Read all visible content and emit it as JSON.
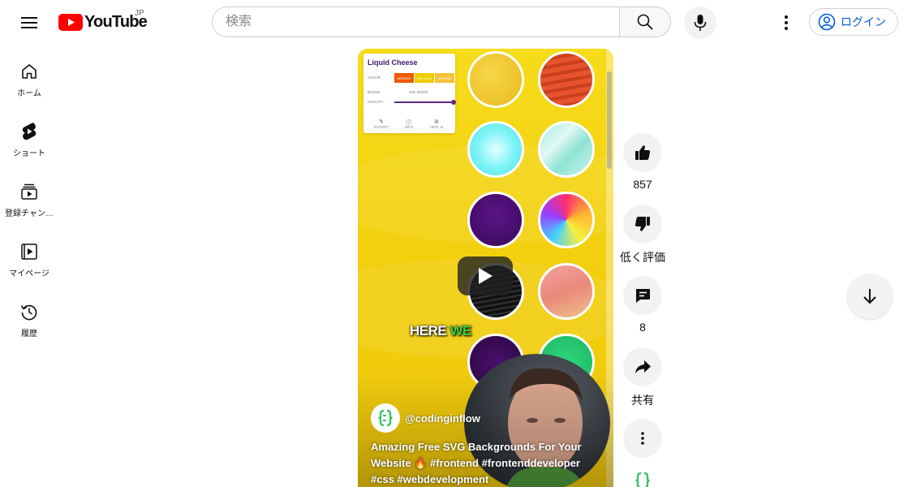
{
  "header": {
    "logo_text": "YouTube",
    "country_code": "JP",
    "search_placeholder": "検索",
    "login_label": "ログイン"
  },
  "sidebar": {
    "items": [
      {
        "label": "ホーム",
        "icon": "home-icon"
      },
      {
        "label": "ショート",
        "icon": "shorts-icon"
      },
      {
        "label": "登録チャン…",
        "icon": "subscriptions-icon"
      },
      {
        "label": "マイページ",
        "icon": "my-page-icon"
      },
      {
        "label": "履歴",
        "icon": "history-icon"
      }
    ]
  },
  "video": {
    "panel": {
      "title": "Liquid Cheese",
      "color_label": "COLOR",
      "swatches": [
        "#EE5A00",
        "#EECC00",
        "#FF1166"
      ],
      "blend_label": "BLEND",
      "blend_value": "HSL MODE",
      "opacity_label": "OPACITY",
      "actions": [
        "EXPORT",
        "INFO",
        "HIDE UI"
      ]
    },
    "caption_white": "HERE",
    "caption_green": "WE",
    "channel": "@codinginflow",
    "title": "Amazing Free SVG Backgrounds For Your Website 🔥 #frontend #frontenddeveloper #css #webdevelopment"
  },
  "actions": {
    "like_count": "857",
    "dislike_label": "低く評価",
    "comment_count": "8",
    "share_label": "共有"
  },
  "colors": {
    "brand_red": "#ff0000",
    "link_blue": "#065fd4",
    "video_yellow": "#f2d10f"
  }
}
